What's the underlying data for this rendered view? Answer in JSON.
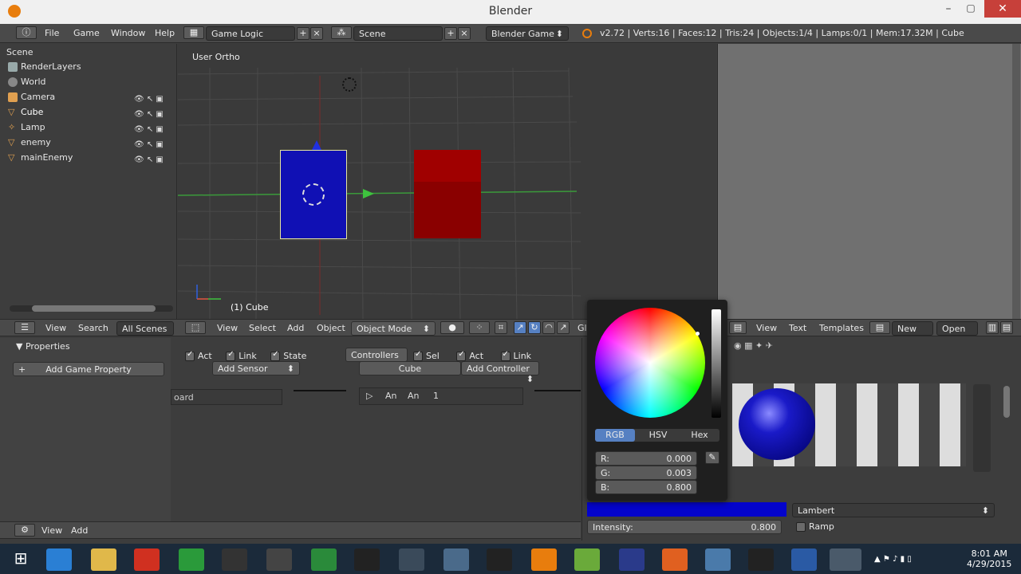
{
  "window": {
    "title": "Blender"
  },
  "menubar": {
    "items": [
      "File",
      "Game",
      "Window",
      "Help"
    ],
    "screen_layout": "Game Logic",
    "scene": "Scene",
    "engine": "Blender Game",
    "stats": "v2.72 | Verts:16 | Faces:12 | Tris:24 | Objects:1/4 | Lamps:0/1 | Mem:17.32M | Cube"
  },
  "outliner": {
    "scene_label": "Scene",
    "items": [
      "RenderLayers",
      "World",
      "Camera",
      "Cube",
      "Lamp",
      "enemy",
      "mainEnemy"
    ]
  },
  "viewport": {
    "view_label": "User Ortho",
    "object_label": "(1) Cube",
    "header": {
      "view": "View",
      "select": "Select",
      "add": "Add",
      "object": "Object",
      "mode": "Object Mode",
      "gl": "Gl"
    }
  },
  "outliner_header": {
    "view": "View",
    "search": "Search",
    "filter": "All Scenes"
  },
  "text_editor_header": {
    "view": "View",
    "text": "Text",
    "templates": "Templates",
    "new": "New",
    "open": "Open"
  },
  "logic": {
    "properties_title": "Properties",
    "add_game_property": "Add Game Property",
    "sensors": {
      "act": "Act",
      "link": "Link",
      "state": "State",
      "add": "Add Sensor",
      "board": "oard"
    },
    "controllers": {
      "select": "Controllers",
      "sel": "Sel",
      "act": "Act",
      "link": "Link",
      "object": "Cube",
      "add": "Add Controller",
      "an1": "An",
      "an2": "An",
      "num": "1"
    },
    "footer": {
      "view": "View",
      "add": "Add"
    }
  },
  "color_picker": {
    "tabs": [
      "RGB",
      "HSV",
      "Hex"
    ],
    "active_tab": "RGB",
    "r_label": "R:",
    "r": "0.000",
    "g_label": "G:",
    "g": "0.003",
    "b_label": "B:",
    "b": "0.800",
    "swatch": "#0404cc"
  },
  "material": {
    "shader": "Lambert",
    "intensity_label": "Intensity:",
    "intensity": "0.800",
    "ramp": "Ramp"
  },
  "taskbar": {
    "time": "8:01 AM",
    "date": "4/29/2015"
  },
  "colors": {
    "accent": "#5680c2",
    "blue_cube": "#1010b4",
    "red_cube": "#8a0000"
  }
}
